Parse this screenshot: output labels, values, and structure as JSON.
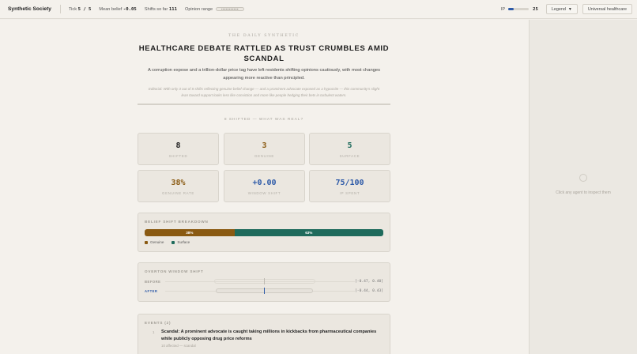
{
  "app": {
    "title": "Synthetic Society"
  },
  "topbar": {
    "tick_label": "Tick",
    "tick_value": "5 / 5",
    "mean_label": "Mean belief",
    "mean_value": "-0.05",
    "shifts_label": "Shifts so far",
    "shifts_value": "111",
    "opinion_label": "Opinion range",
    "ip_label": "IP",
    "ip_value": "25",
    "ip_fraction": 0.25,
    "legend_label": "Legend",
    "scenario_label": "Universal healthcare"
  },
  "article": {
    "kicker": "THE DAILY SYNTHETIC",
    "headline": "HEALTHCARE DEBATE RATTLED AS TRUST CRUMBLES AMID SCANDAL",
    "dek": "A corruption expose and a trillion-dollar price tag have left residents shifting opinions cautiously, with most changes appearing more reactive than principled.",
    "editorial": "Editorial: With only 3 out of 8 shifts reflecting genuine belief change — and a prominent advocate exposed as a hypocrite — this community's slight lean toward support looks less like conviction and more like people hedging their bets in turbulent waters."
  },
  "shift_section": {
    "title": "8 SHIFTED — WHAT WAS REAL?"
  },
  "stats": [
    {
      "value": "8",
      "label": "SHIFTED",
      "color": "#222222"
    },
    {
      "value": "3",
      "label": "GENUINE",
      "color": "#8a5a12"
    },
    {
      "value": "5",
      "label": "SURFACE",
      "color": "#1f6b5c"
    },
    {
      "value": "38%",
      "label": "GENUINE RATE",
      "color": "#8a5a12"
    },
    {
      "value": "+0.00",
      "label": "WINDOW SHIFT",
      "color": "#2d5aa8"
    },
    {
      "value": "75/100",
      "label": "IP SPENT",
      "color": "#2d5aa8"
    }
  ],
  "breakdown": {
    "title": "BELIEF SHIFT BREAKDOWN",
    "genuine_label": "38%",
    "genuine_fraction": 0.38,
    "genuine_color": "#8a5a12",
    "surface_label": "63%",
    "surface_fraction": 0.63,
    "surface_color": "#1f6b5c",
    "legend_genuine": "Genuine",
    "legend_surface": "Surface"
  },
  "overton": {
    "title": "OVERTON WINDOW SHIFT",
    "before_label": "BEFORE",
    "before_range": "[-0.47, 0.40]",
    "after_label": "AFTER",
    "after_range": "[-0.44, 0.43]",
    "accent": "#2d5aa8"
  },
  "events": {
    "title": "EVENTS (2)",
    "items": [
      {
        "number": "1",
        "text": "Scandal: A prominent advocate is caught taking millions in kickbacks from pharmaceutical companies while publicly opposing drug price reforms",
        "meta": "10 affected — scandal"
      }
    ]
  },
  "inspector": {
    "empty_text": "Click any agent to inspect them"
  }
}
